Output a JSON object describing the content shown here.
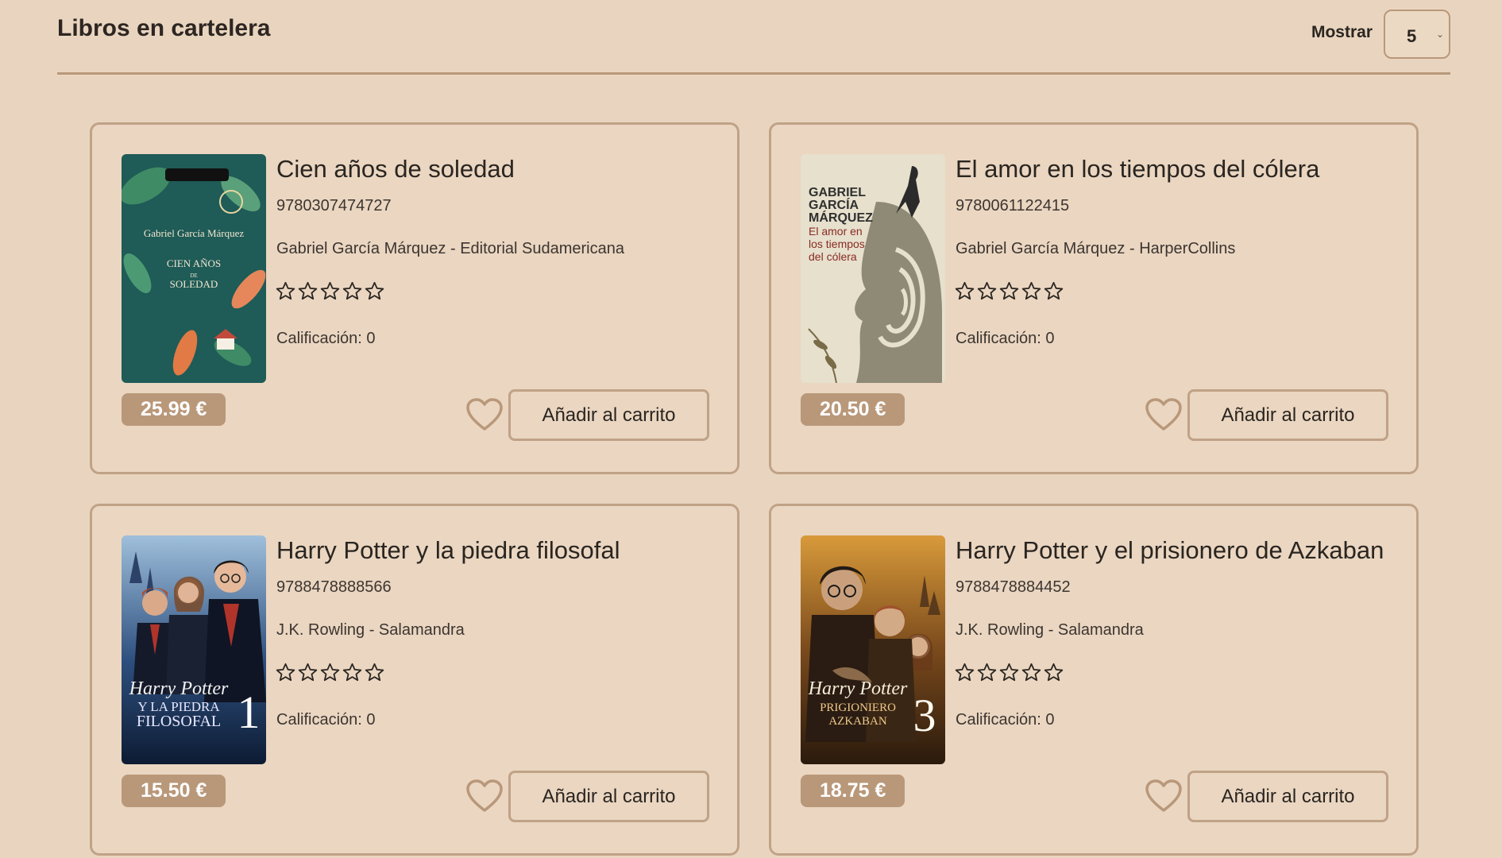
{
  "header": {
    "title": "Libros en cartelera",
    "show_label": "Mostrar",
    "show_value": "5"
  },
  "colors": {
    "background": "#e9d5bf",
    "accent": "#b9987a",
    "border": "#c0a287"
  },
  "icons": {
    "rating": "star-outline-icon",
    "favorite": "heart-outline-icon",
    "select": "chevron-down-icon"
  },
  "books": [
    {
      "title": "Cien años de soledad",
      "isbn": "9780307474727",
      "author_publisher": "Gabriel García Márquez - Editorial Sudamericana",
      "rating": "Calificación: 0",
      "price": "25.99 €",
      "cart_label": "Añadir al carrito"
    },
    {
      "title": "El amor en los tiempos del cólera",
      "isbn": "9780061122415",
      "author_publisher": "Gabriel García Márquez - HarperCollins",
      "rating": "Calificación: 0",
      "price": "20.50 €",
      "cart_label": "Añadir al carrito"
    },
    {
      "title": "Harry Potter y la piedra filosofal",
      "isbn": "9788478888566",
      "author_publisher": "J.K. Rowling - Salamandra",
      "rating": "Calificación: 0",
      "price": "15.50 €",
      "cart_label": "Añadir al carrito"
    },
    {
      "title": "Harry Potter y el prisionero de Azkaban",
      "isbn": "9788478884452",
      "author_publisher": "J.K. Rowling - Salamandra",
      "rating": "Calificación: 0",
      "price": "18.75 €",
      "cart_label": "Añadir al carrito"
    }
  ],
  "covers": {
    "cien": {
      "author": "Gabriel García Márquez",
      "line1": "CIEN AÑOS",
      "line2": "DE",
      "line3": "SOLEDAD"
    },
    "amor": {
      "line1": "GABRIEL",
      "line2": "GARCÍA",
      "line3": "MÁRQUEZ",
      "line4": "El amor en",
      "line5": "los tiempos",
      "line6": "del cólera"
    },
    "hp1": {
      "brand": "Harry Potter",
      "line1": "Y LA PIEDRA",
      "line2": "FILOSOFAL",
      "num": "1"
    },
    "hp3": {
      "brand": "Harry Potter",
      "line1": "PRIGIONIERO",
      "line2": "AZKABAN",
      "num": "3"
    }
  }
}
